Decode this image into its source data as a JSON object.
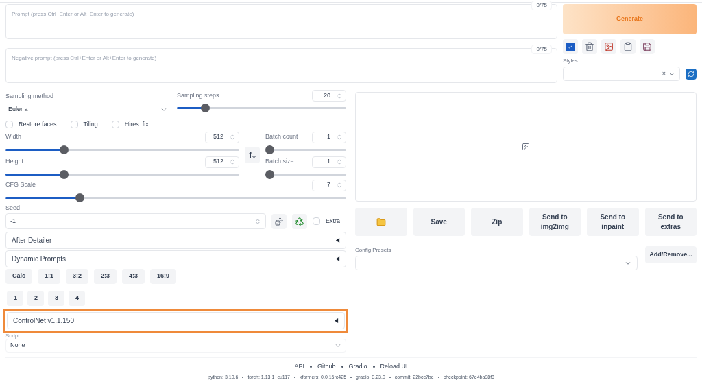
{
  "prompt": {
    "placeholder": "Prompt (press Ctrl+Enter or Alt+Enter to generate)",
    "token_count": "0/75"
  },
  "negative_prompt": {
    "placeholder": "Negative prompt (press Ctrl+Enter or Alt+Enter to generate)",
    "token_count": "0/75"
  },
  "generate_button": "Generate",
  "tool_buttons": [
    {
      "kind": "check"
    },
    {
      "kind": "trash"
    },
    {
      "kind": "picture"
    },
    {
      "kind": "clipboard"
    },
    {
      "kind": "save"
    }
  ],
  "styles": {
    "label": "Styles",
    "clear": "×"
  },
  "sampling_method": {
    "label": "Sampling method",
    "value": "Euler a"
  },
  "sampling_steps": {
    "label": "Sampling steps",
    "value": "20",
    "level": 0.15
  },
  "checkboxes": [
    {
      "label": "Restore faces",
      "checked": false
    },
    {
      "label": "Tiling",
      "checked": false
    },
    {
      "label": "Hires. fix",
      "checked": false
    }
  ],
  "width": {
    "label": "Width",
    "value": "512",
    "level": 0.24
  },
  "height": {
    "label": "Height",
    "value": "512",
    "level": 0.24
  },
  "batch_count": {
    "label": "Batch count",
    "value": "1",
    "level": 0
  },
  "batch_size": {
    "label": "Batch size",
    "value": "1",
    "level": 0
  },
  "cfg_scale": {
    "label": "CFG Scale",
    "value": "7",
    "level": 0.21
  },
  "seed": {
    "label": "Seed",
    "value": "-1",
    "extra": {
      "label": "Extra",
      "checked": false
    }
  },
  "accordions": [
    {
      "title": "After Detailer",
      "expanded": false
    },
    {
      "title": "Dynamic Prompts",
      "expanded": false
    }
  ],
  "ratio_buttons": [
    "Calc",
    "1:1",
    "3:2",
    "2:3",
    "4:3",
    "16:9"
  ],
  "number_buttons": [
    "1",
    "2",
    "3",
    "4"
  ],
  "controlnet": {
    "title": "ControlNet v1.1.150",
    "expanded": false,
    "highlighted": true
  },
  "script": {
    "label": "Script",
    "value": "None"
  },
  "output_buttons": [
    {
      "kind": "folder"
    },
    {
      "kind": "text",
      "label": "Save"
    },
    {
      "kind": "text",
      "label": "Zip"
    },
    {
      "kind": "text",
      "label": "Send to img2img"
    },
    {
      "kind": "text",
      "label": "Send to inpaint"
    },
    {
      "kind": "text",
      "label": "Send to extras"
    }
  ],
  "config_presets": {
    "label": "Config Presets",
    "button": "Add/Remove..."
  },
  "footer": {
    "links": [
      "API",
      "Github",
      "Gradio",
      "Reload UI"
    ],
    "versions": [
      "python: 3.10.6",
      "torch: 1.13.1+cu117",
      "xformers: 0.0.16rc425",
      "gradio: 3.23.0",
      "commit: 22bcc7be",
      "checkpoint: 67e4ba98f8"
    ]
  }
}
